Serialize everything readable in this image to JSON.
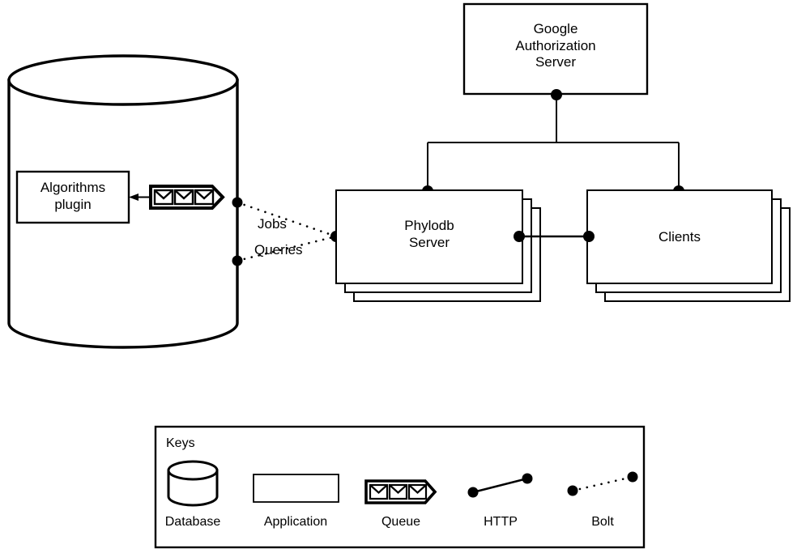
{
  "diagram": {
    "title": "PhyloDB system architecture diagram",
    "nodes": {
      "google_auth": {
        "label": "Google\nAuthorization\nServer",
        "type": "application"
      },
      "phylodb_server": {
        "label": "Phylodb\nServer",
        "type": "application-stack"
      },
      "clients": {
        "label": "Clients",
        "type": "application-stack"
      },
      "database": {
        "label": "",
        "type": "database"
      },
      "algorithms_plugin": {
        "label": "Algorithms\nplugin",
        "type": "application"
      },
      "queue": {
        "label": "",
        "type": "queue"
      }
    },
    "edge_labels": {
      "jobs": "Jobs",
      "queries": "Queries"
    }
  },
  "legend": {
    "title": "Keys",
    "items": [
      {
        "label": "Database",
        "icon": "database-cylinder-icon"
      },
      {
        "label": "Application",
        "icon": "application-rectangle-icon"
      },
      {
        "label": "Queue",
        "icon": "queue-envelopes-icon"
      },
      {
        "label": "HTTP",
        "icon": "http-solid-line-icon"
      },
      {
        "label": "Bolt",
        "icon": "bolt-dotted-line-icon"
      }
    ]
  },
  "colors": {
    "stroke": "#000000",
    "background": "#ffffff",
    "fill": "#ffffff"
  }
}
